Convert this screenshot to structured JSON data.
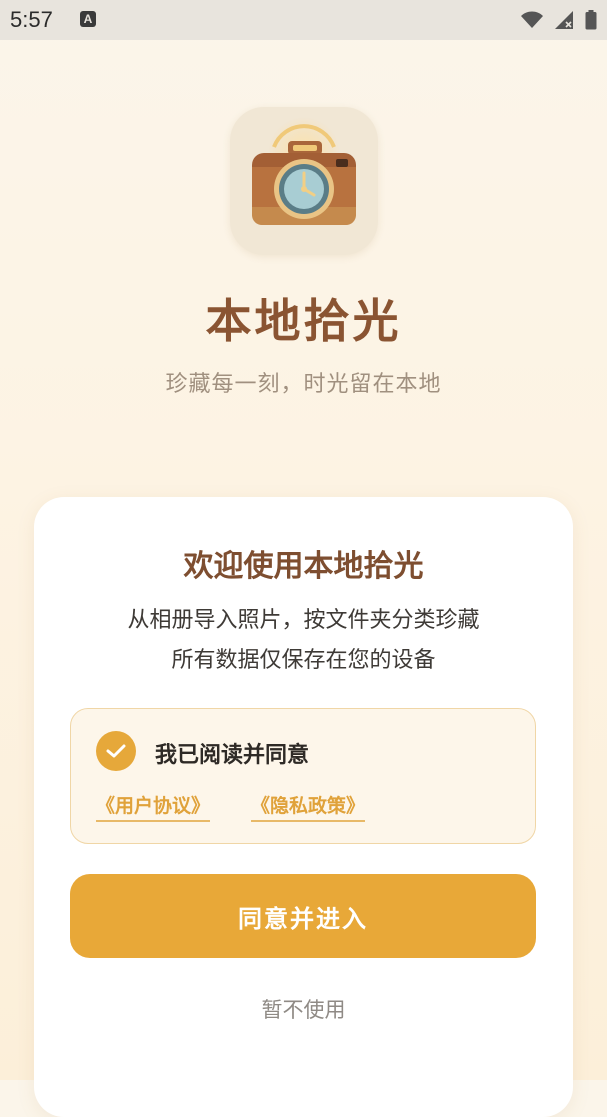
{
  "status_bar": {
    "time": "5:57",
    "notification_badge": "A",
    "icons": [
      "wifi-icon",
      "signal-icon",
      "battery-icon"
    ]
  },
  "app": {
    "name": "本地拾光",
    "slogan": "珍藏每一刻，时光留在本地",
    "icon": "camera-icon"
  },
  "welcome_card": {
    "title": "欢迎使用本地拾光",
    "description_line1": "从相册导入照片，按文件夹分类珍藏",
    "description_line2": "所有数据仅保存在您的设备",
    "agreement": {
      "checked": true,
      "label": "我已阅读并同意",
      "user_agreement_link": "《用户协议》",
      "privacy_policy_link": "《隐私政策》"
    },
    "primary_button": "同意并进入",
    "secondary_button": "暂不使用"
  },
  "colors": {
    "accent": "#e8a838",
    "brand_brown": "#8a5432",
    "link": "#e0a23a"
  }
}
